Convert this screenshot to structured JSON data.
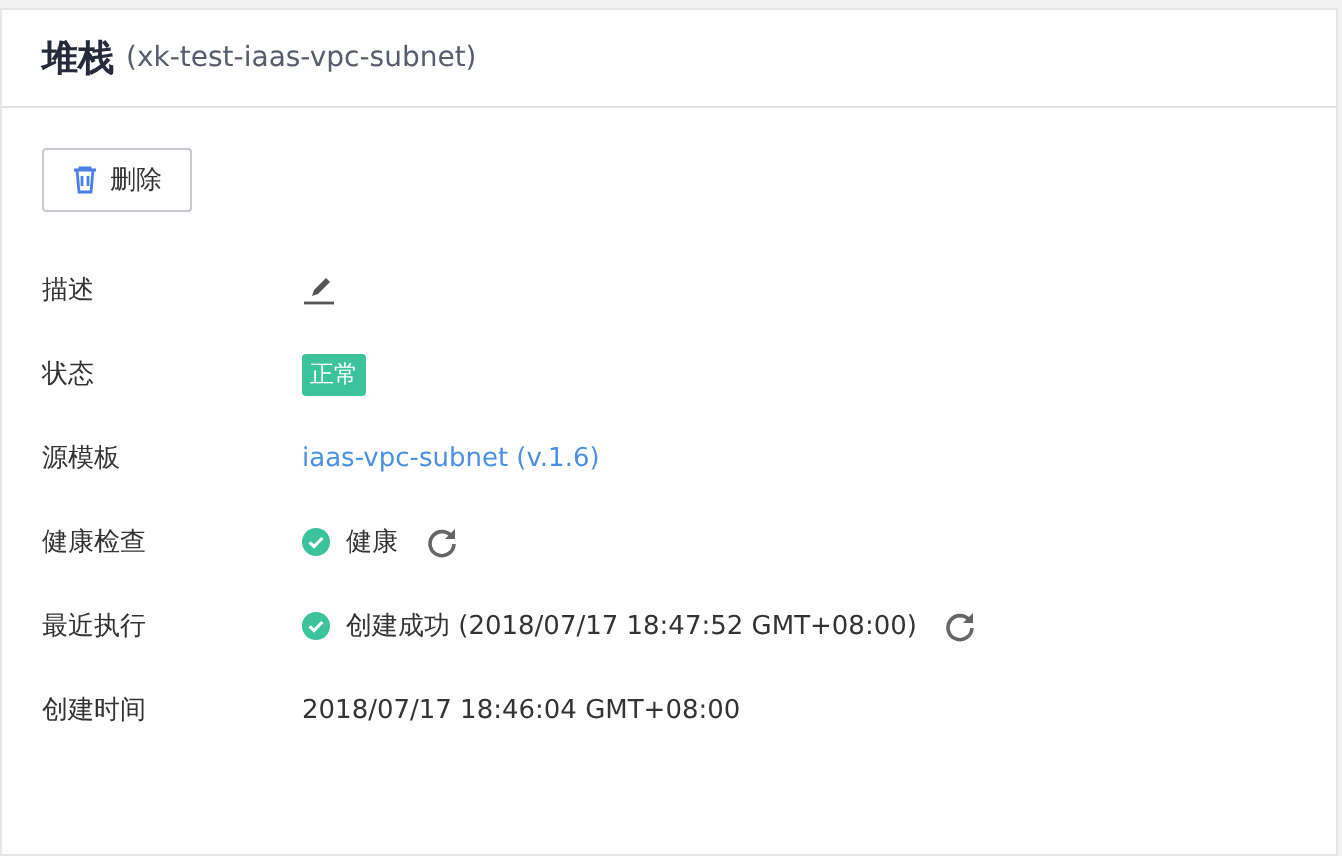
{
  "header": {
    "title": "堆栈",
    "subtitle": "(xk-test-iaas-vpc-subnet)"
  },
  "toolbar": {
    "buttons": [
      {
        "label": "删除",
        "kind": "delete"
      }
    ]
  },
  "details": [
    {
      "label": "描述",
      "kind": "edit"
    },
    {
      "label": "状态",
      "kind": "tag",
      "value": "正常",
      "color": "#3dc39b"
    },
    {
      "label": "源模板",
      "kind": "link",
      "value": "iaas-vpc-subnet (v.1.6)"
    },
    {
      "label": "健康检查",
      "kind": "status",
      "value": "健康",
      "refreshable": true
    },
    {
      "label": "最近执行",
      "kind": "status",
      "value": "创建成功 (2018/07/17 18:47:52 GMT+08:00)",
      "refreshable": true
    },
    {
      "label": "创建时间",
      "kind": "text",
      "value": "2018/07/17 18:46:04 GMT+08:00"
    }
  ]
}
